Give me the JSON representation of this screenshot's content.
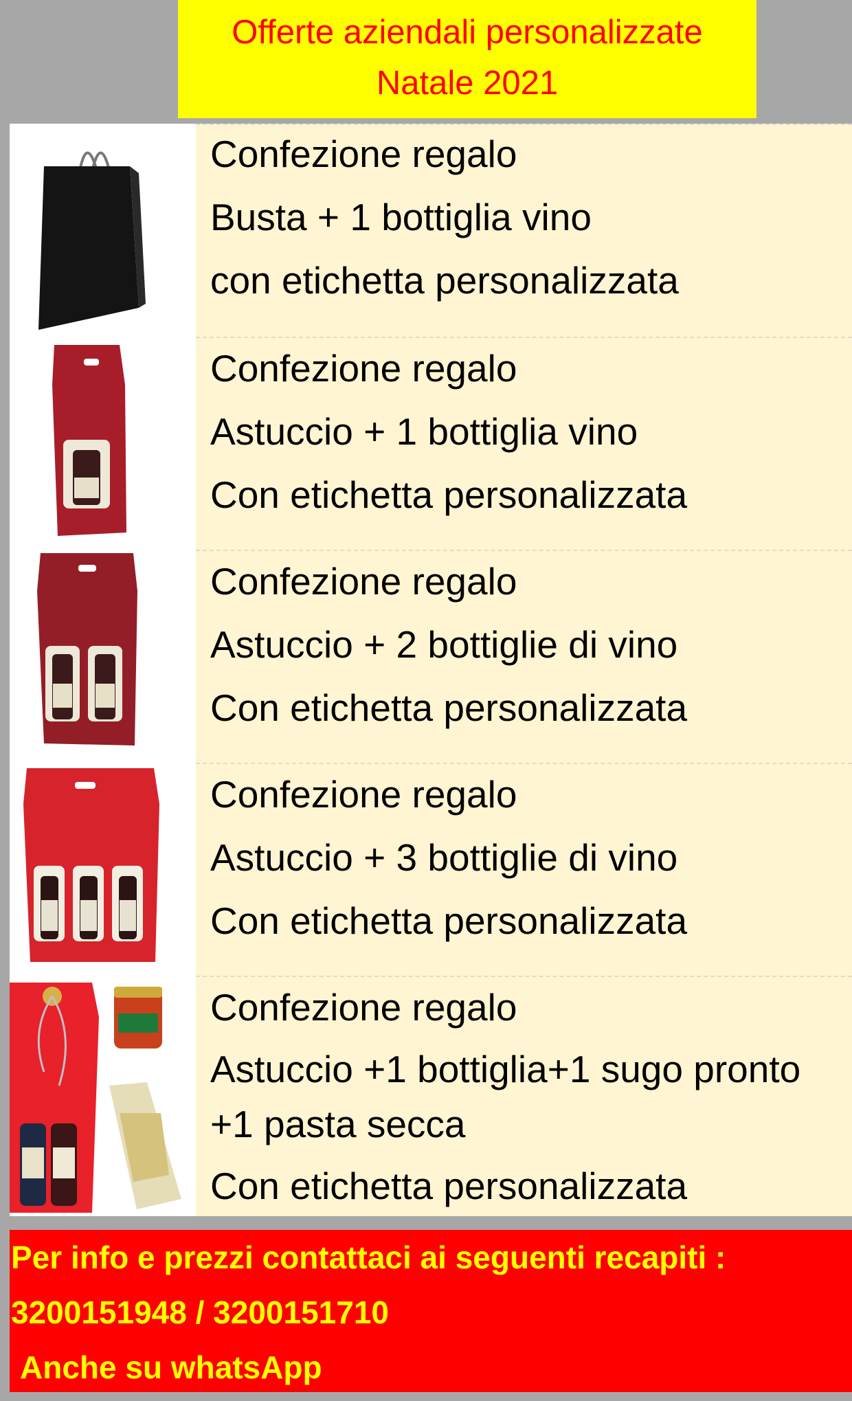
{
  "header": {
    "line1": "Offerte aziendali personalizzate",
    "line2": "Natale 2021"
  },
  "offers": [
    {
      "line1": "Confezione regalo",
      "line2": "Busta + 1 bottiglia vino",
      "line3": "con etichetta personalizzata",
      "image": "black-gift-bag"
    },
    {
      "line1": "Confezione regalo",
      "line2": "Astuccio + 1 bottiglia vino",
      "line3": "Con etichetta personalizzata",
      "image": "red-box-1-bottle"
    },
    {
      "line1": "Confezione regalo",
      "line2": "Astuccio + 2 bottiglie di vino",
      "line3": "Con etichetta personalizzata",
      "image": "red-box-2-bottles"
    },
    {
      "line1": "Confezione regalo",
      "line2": "Astuccio + 3 bottiglie di vino",
      "line3": "Con etichetta personalizzata",
      "image": "red-box-3-bottles"
    },
    {
      "line1": "Confezione regalo",
      "line2": "Astuccio +1 bottiglia+1 sugo pronto",
      "line3": "+1 pasta secca",
      "line4": "Con etichetta personalizzata",
      "image": "red-box-bottles-sauce-pasta"
    }
  ],
  "footer": {
    "line1": "Per info e prezzi contattaci  ai seguenti recapiti :",
    "line2": "3200151948 / 3200151710",
    "line3": "Anche su whatsApp"
  },
  "colors": {
    "background": "#a7a7a7",
    "header_bg": "#ffff00",
    "header_text": "#ff0000",
    "row_bg": "#fff5d2",
    "footer_bg": "#ff0000",
    "footer_text": "#ffff00"
  }
}
